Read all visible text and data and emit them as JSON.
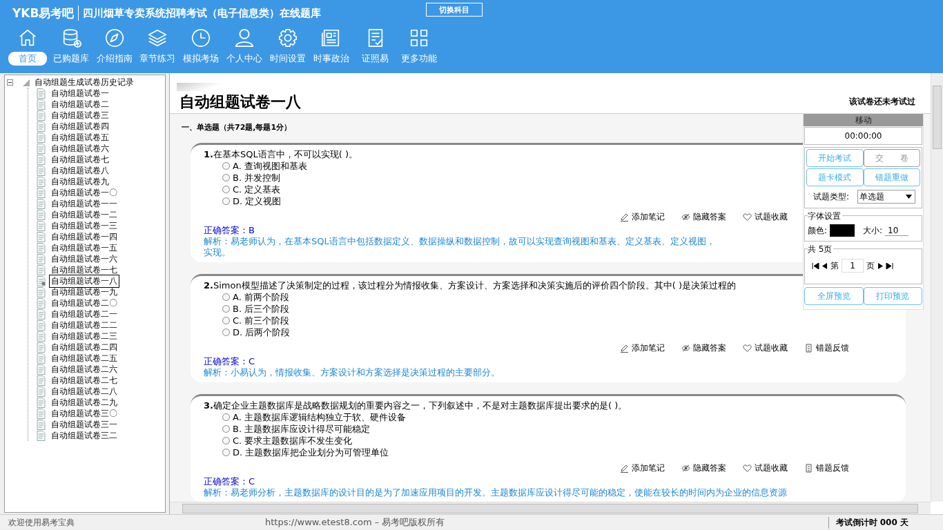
{
  "header": {
    "logo": "YKB易考吧",
    "title": "四川烟草专卖系统招聘考试（电子信息类）在线题库",
    "switch_button": "切换科目"
  },
  "toolbar": [
    {
      "label": "首页",
      "selected": true
    },
    {
      "label": "已购题库",
      "selected": false
    },
    {
      "label": "介绍指南",
      "selected": false
    },
    {
      "label": "章节练习",
      "selected": false
    },
    {
      "label": "模拟考场",
      "selected": false
    },
    {
      "label": "个人中心",
      "selected": false
    },
    {
      "label": "时间设置",
      "selected": false
    },
    {
      "label": "时事政治",
      "selected": false
    },
    {
      "label": "证照易",
      "selected": false
    },
    {
      "label": "更多功能",
      "selected": false
    }
  ],
  "tree": {
    "label": "自动组题生成试卷历史记录",
    "expanded": true,
    "children": [
      {
        "label": "自动组题试卷一",
        "selected": false
      },
      {
        "label": "自动组题试卷二",
        "selected": false
      },
      {
        "label": "自动组题试卷三",
        "selected": false
      },
      {
        "label": "自动组题试卷四",
        "selected": false
      },
      {
        "label": "自动组题试卷五",
        "selected": false
      },
      {
        "label": "自动组题试卷六",
        "selected": false
      },
      {
        "label": "自动组题试卷七",
        "selected": false
      },
      {
        "label": "自动组题试卷八",
        "selected": false
      },
      {
        "label": "自动组题试卷九",
        "selected": false
      },
      {
        "label": "自动组题试卷一〇",
        "selected": false
      },
      {
        "label": "自动组题试卷一一",
        "selected": false
      },
      {
        "label": "自动组题试卷一二",
        "selected": false
      },
      {
        "label": "自动组题试卷一三",
        "selected": false
      },
      {
        "label": "自动组题试卷一四",
        "selected": false
      },
      {
        "label": "自动组题试卷一五",
        "selected": false
      },
      {
        "label": "自动组题试卷一六",
        "selected": false
      },
      {
        "label": "自动组题试卷一七",
        "selected": false
      },
      {
        "label": "自动组题试卷一八",
        "selected": true
      },
      {
        "label": "自动组题试卷一九",
        "selected": false
      },
      {
        "label": "自动组题试卷二〇",
        "selected": false
      },
      {
        "label": "自动组题试卷二一",
        "selected": false
      },
      {
        "label": "自动组题试卷二二",
        "selected": false
      },
      {
        "label": "自动组题试卷二三",
        "selected": false
      },
      {
        "label": "自动组题试卷二四",
        "selected": false
      },
      {
        "label": "自动组题试卷二五",
        "selected": false
      },
      {
        "label": "自动组题试卷二六",
        "selected": false
      },
      {
        "label": "自动组题试卷二七",
        "selected": false
      },
      {
        "label": "自动组题试卷二八",
        "selected": false
      },
      {
        "label": "自动组题试卷二九",
        "selected": false
      },
      {
        "label": "自动组题试卷三〇",
        "selected": false
      },
      {
        "label": "自动组题试卷三一",
        "selected": false
      },
      {
        "label": "自动组题试卷三二",
        "selected": false
      }
    ]
  },
  "paper": {
    "title": "自动组题试卷一八",
    "status": "该试卷还未考试过",
    "section": "一、单选题（共72题,每题1分）"
  },
  "questions": [
    {
      "number": "1.",
      "text": "在基本SQL语言中，不可以实现( )。",
      "options": [
        {
          "label": "A. 查询视图和基表",
          "selected": false
        },
        {
          "label": "B. 并发控制",
          "selected": false
        },
        {
          "label": "C. 定义基表",
          "selected": false
        },
        {
          "label": "D. 定义视图",
          "selected": false
        }
      ],
      "actions": [
        "添加笔记",
        "隐藏答案",
        "试题收藏"
      ],
      "answer": "正确答案：B",
      "explanation": [
        "解析：易老师认为，在基本SQL语言中包括数据定义、数据操纵和数据控制，故可以实现查询视图和基表、定义基表、定义视图，",
        "实现。"
      ]
    },
    {
      "number": "2.",
      "text": "Simon模型描述了决策制定的过程，该过程分为情报收集、方案设计、方案选择和决策实施后的评价四个阶段。其中( )是决策过程的",
      "options": [
        {
          "label": "A. 前两个阶段",
          "selected": false
        },
        {
          "label": "B. 后三个阶段",
          "selected": false
        },
        {
          "label": "C. 前三个阶段",
          "selected": false
        },
        {
          "label": "D. 后两个阶段",
          "selected": false
        }
      ],
      "actions": [
        "添加笔记",
        "隐藏答案",
        "试题收藏",
        "错题反馈"
      ],
      "answer": "正确答案：C",
      "explanation": [
        "解析：小易认为，情报收集、方案设计和方案选择是决策过程的主要部分。"
      ]
    },
    {
      "number": "3.",
      "text": "确定企业主题数据库是战略数据规划的重要内容之一，下列叙述中，不是对主题数据库提出要求的是( )。",
      "options": [
        {
          "label": "A. 主题数据库逻辑结构独立于软、硬件设备",
          "selected": false
        },
        {
          "label": "B. 主题数据库应设计得尽可能稳定",
          "selected": false
        },
        {
          "label": "C. 要求主题数据库不发生变化",
          "selected": false
        },
        {
          "label": "D. 主题数据库把企业划分为可管理单位",
          "selected": false
        }
      ],
      "actions": [
        "添加笔记",
        "隐藏答案",
        "试题收藏",
        "错题反馈"
      ],
      "answer": "正确答案：C",
      "explanation": [
        "解析：易老师分析，主题数据库的设计目的是为了加速应用项目的开发。主题数据库应设计得尽可能的稳定，使能在较长的时间内为企业的信息资源"
      ]
    }
  ],
  "panel": {
    "title": "移动",
    "timer": "00:00:00",
    "buttons": [
      {
        "label": "开始考试",
        "disabled": false
      },
      {
        "label": "交　　卷",
        "disabled": true
      },
      {
        "label": "题卡模式",
        "disabled": false
      },
      {
        "label": "错题重做",
        "disabled": false
      }
    ],
    "type_label": "试题类型:",
    "type_value": "单选题",
    "font_group": "字体设置",
    "color_label": "颜色:",
    "size_label": "大小:",
    "size_value": "10",
    "pages_group": "共 5页",
    "page_prefix": "第",
    "page_value": "1",
    "page_suffix": "页",
    "bottom_buttons": [
      "全屏预览",
      "打印预览"
    ]
  },
  "status_bar": {
    "welcome": "欢迎使用易考宝典",
    "copyright": "https://www.etest8.com – 易考吧版权所有",
    "countdown": "考试倒计时 000 天"
  }
}
